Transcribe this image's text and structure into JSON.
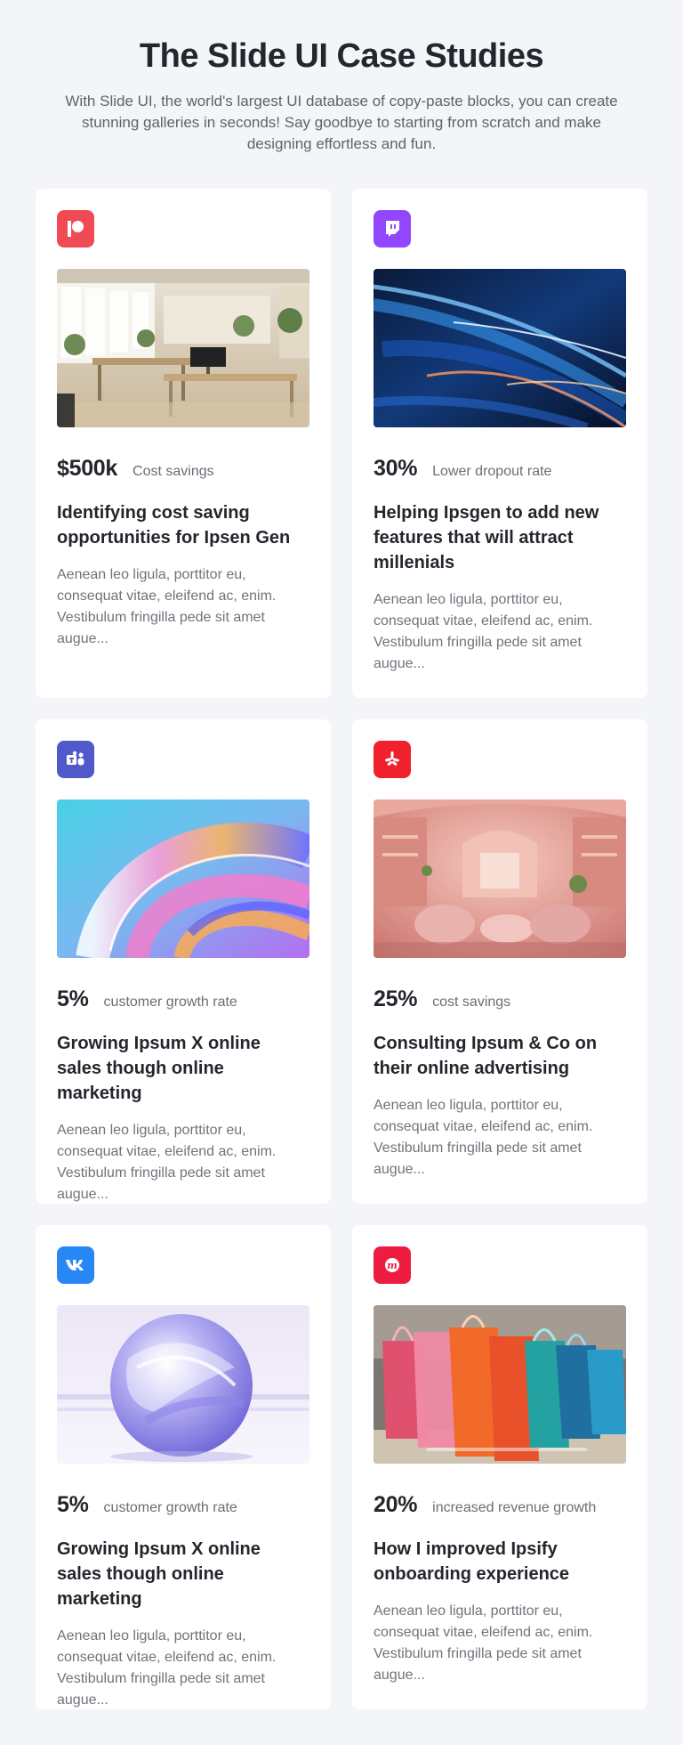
{
  "hero": {
    "title": "The Slide UI Case Studies",
    "subtitle": "With Slide UI, the world's largest UI database of copy-paste blocks, you can create stunning galleries in seconds! Say goodbye to starting from scratch and make designing effortless and fun."
  },
  "cards": [
    {
      "icon": "patreon-icon",
      "icon_color": "#f04b54",
      "image": "office-interior-image",
      "stat_value": "$500k",
      "stat_label": "Cost savings",
      "title": "Identifying cost saving opportunities for Ipsen Gen",
      "description": "Aenean leo ligula, porttitor eu, consequat vitae, eleifend ac, enim. Vestibulum fringilla pede sit amet augue..."
    },
    {
      "icon": "twitch-icon",
      "icon_color": "#9146ff",
      "image": "abstract-blue-streaks-image",
      "stat_value": "30%",
      "stat_label": "Lower dropout rate",
      "title": "Helping Ipsgen to add new features that will attract millenials",
      "description": "Aenean leo ligula, porttitor eu, consequat vitae, eleifend ac, enim. Vestibulum fringilla pede sit amet augue..."
    },
    {
      "icon": "teams-icon",
      "icon_color": "#5059c9",
      "image": "iridescent-swirl-image",
      "stat_value": "5%",
      "stat_label": "customer growth rate",
      "title": "Growing Ipsum X online sales though online marketing",
      "description": "Aenean leo ligula, porttitor eu, consequat vitae, eleifend ac, enim. Vestibulum fringilla pede sit amet augue..."
    },
    {
      "icon": "yelp-icon",
      "icon_color": "#f0202c",
      "image": "pink-interior-image",
      "stat_value": "25%",
      "stat_label": "cost savings",
      "title": "Consulting Ipsum & Co on their online advertising",
      "description": "Aenean leo ligula, porttitor eu, consequat vitae, eleifend ac, enim. Vestibulum fringilla pede sit amet augue..."
    },
    {
      "icon": "vk-icon",
      "icon_color": "#2787f5",
      "image": "glass-sphere-image",
      "stat_value": "5%",
      "stat_label": "customer growth rate",
      "title": "Growing Ipsum X online sales though online marketing",
      "description": "Aenean leo ligula, porttitor eu, consequat vitae, eleifend ac, enim. Vestibulum fringilla pede sit amet augue..."
    },
    {
      "icon": "meetup-icon",
      "icon_color": "#ed1c40",
      "image": "shopping-bags-image",
      "stat_value": "20%",
      "stat_label": "increased revenue growth",
      "title": "How I improved Ipsify onboarding experience",
      "description": "Aenean leo ligula, porttitor eu, consequat vitae, eleifend ac, enim. Vestibulum fringilla pede sit amet augue..."
    }
  ]
}
